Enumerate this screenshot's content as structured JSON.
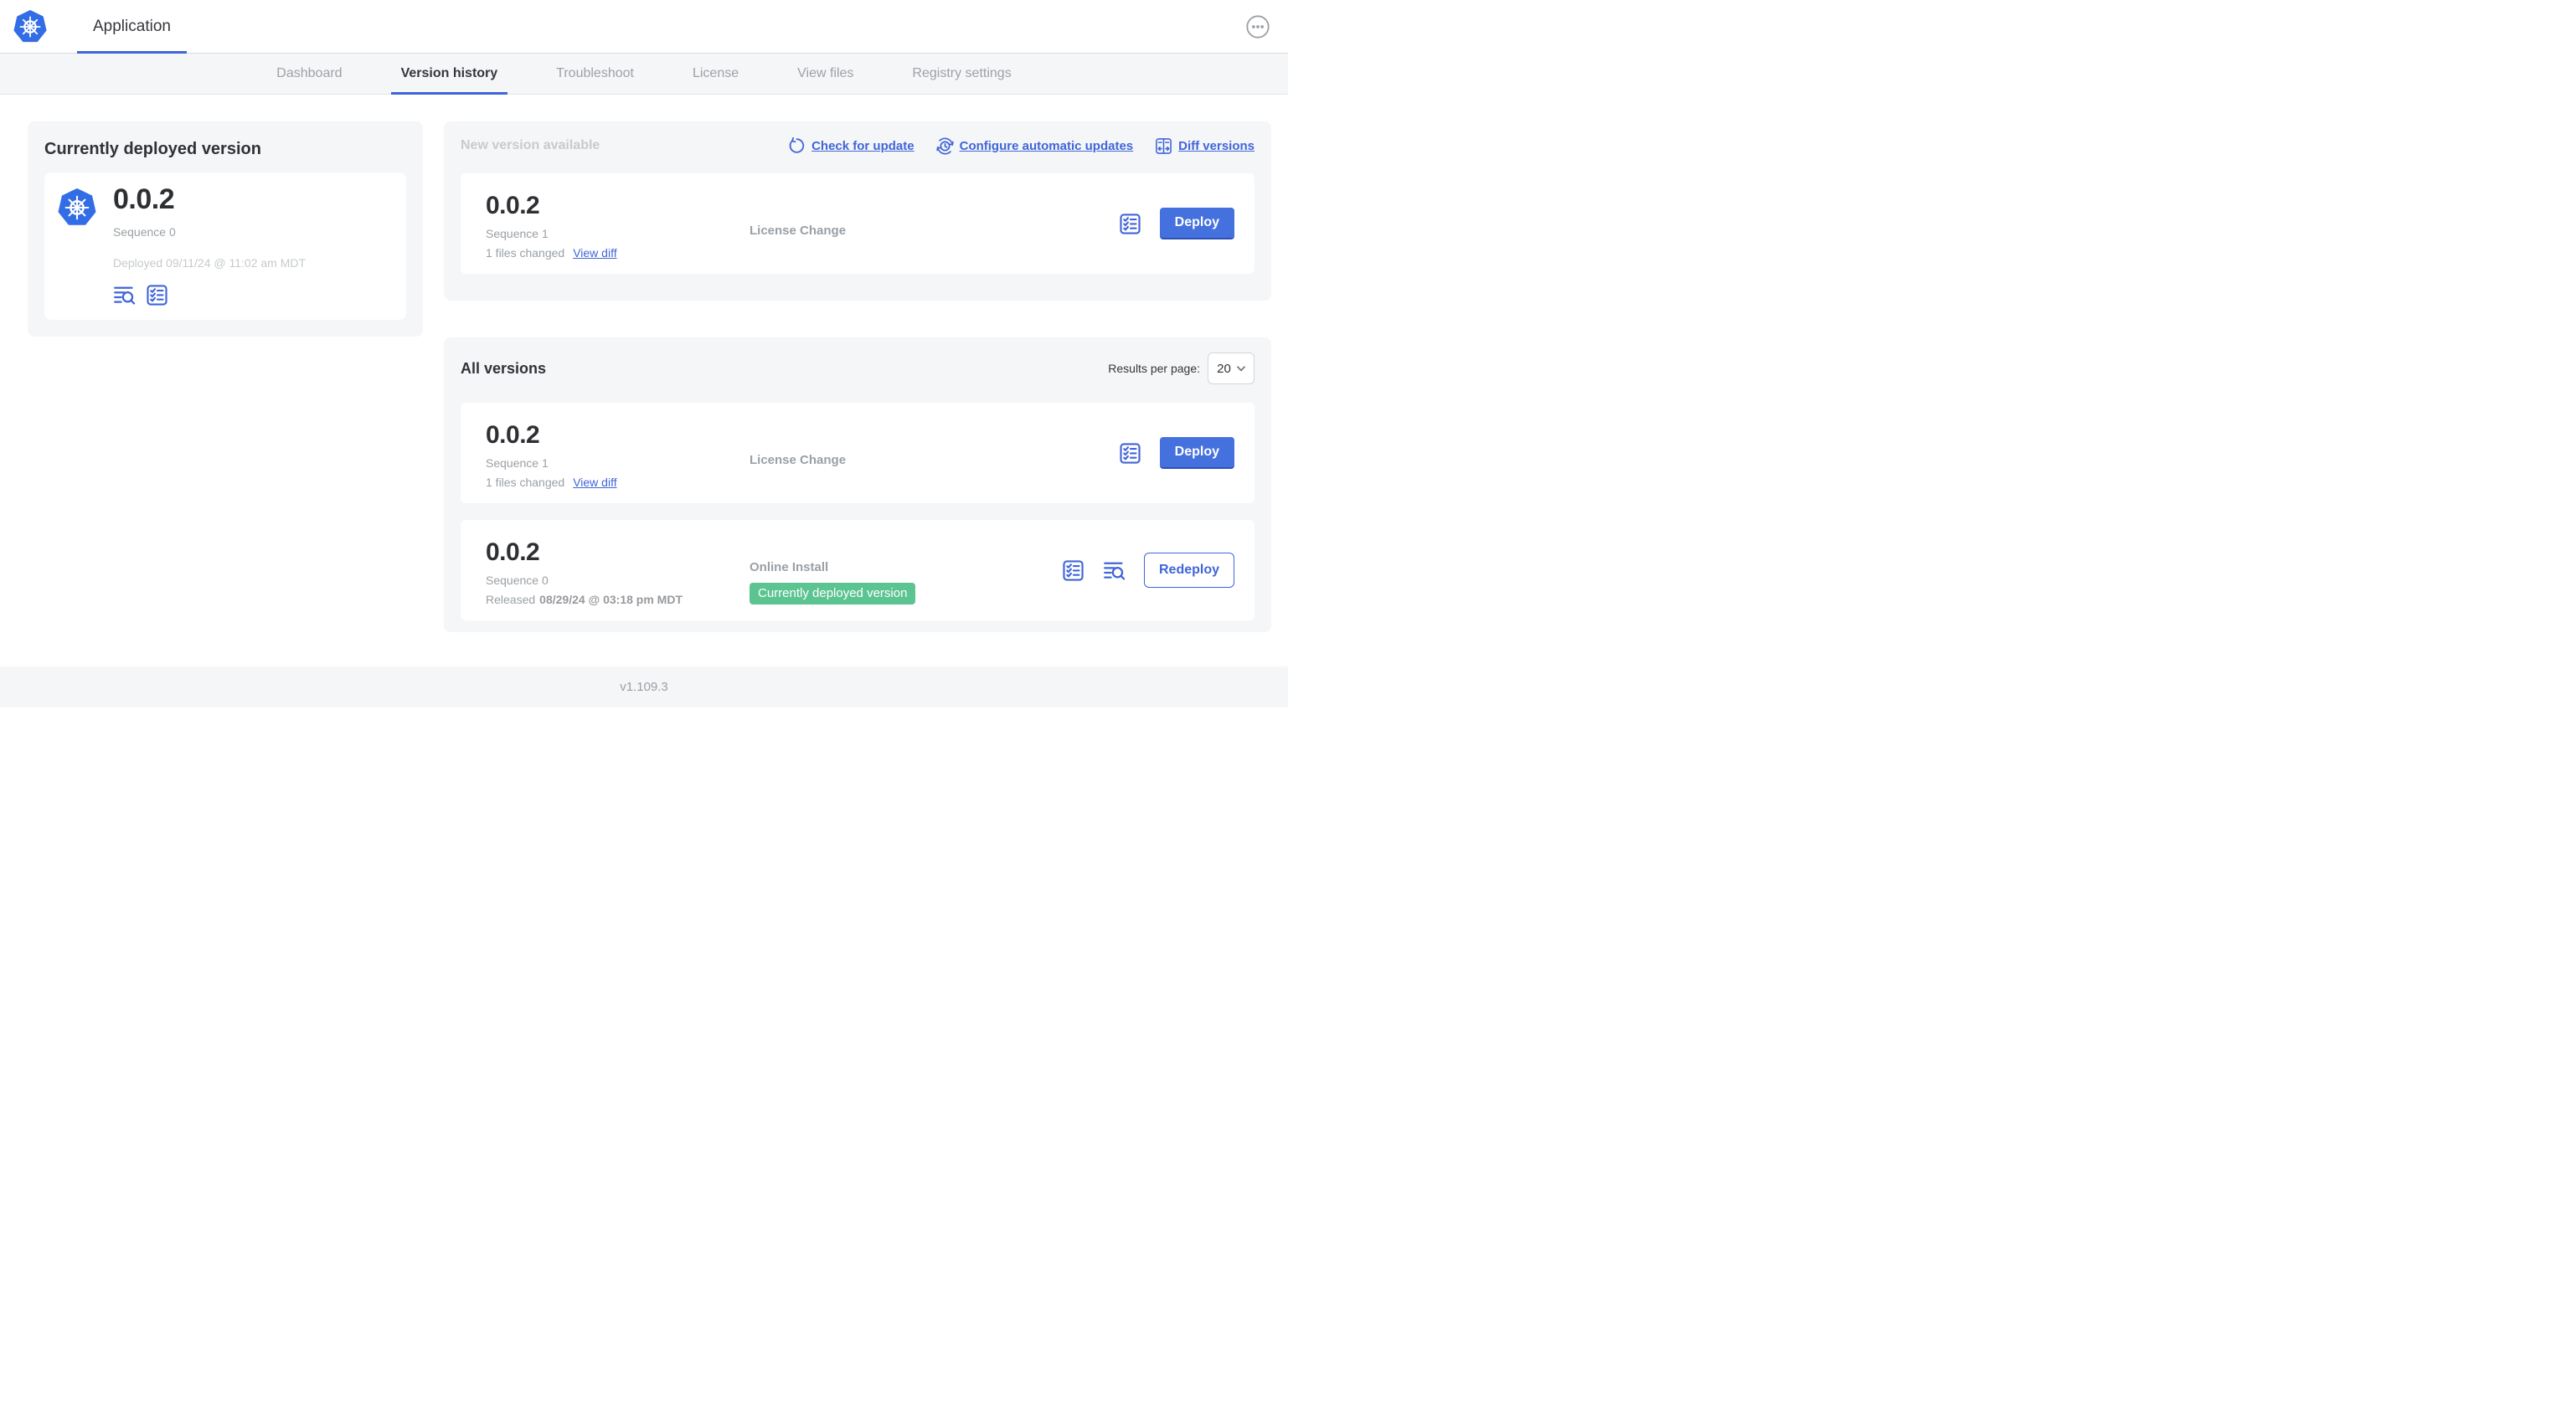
{
  "header": {
    "app_title": "Application"
  },
  "tabs": [
    {
      "label": "Dashboard"
    },
    {
      "label": "Version history"
    },
    {
      "label": "Troubleshoot"
    },
    {
      "label": "License"
    },
    {
      "label": "View files"
    },
    {
      "label": "Registry settings"
    }
  ],
  "currently_deployed": {
    "title": "Currently deployed version",
    "version": "0.0.2",
    "sequence": "Sequence 0",
    "deployed_at": "Deployed 09/11/24 @ 11:02 am MDT"
  },
  "new_version": {
    "title": "New version available",
    "links": [
      {
        "label": "Check for update",
        "icon": "refresh-icon"
      },
      {
        "label": "Configure automatic updates",
        "icon": "schedule-update-icon"
      },
      {
        "label": "Diff versions",
        "icon": "diff-icon"
      }
    ],
    "entry": {
      "version": "0.0.2",
      "sequence": "Sequence 1",
      "files_changed": "1 files changed",
      "view_diff_label": "View diff",
      "source": "License Change",
      "deploy_label": "Deploy"
    }
  },
  "all_versions": {
    "title": "All versions",
    "results_per_page_label": "Results per page:",
    "results_per_page_value": "20",
    "rows": [
      {
        "version": "0.0.2",
        "sequence": "Sequence 1",
        "files_changed": "1 files changed",
        "view_diff_label": "View diff",
        "source": "License Change",
        "deploy_label": "Deploy"
      },
      {
        "version": "0.0.2",
        "sequence": "Sequence 0",
        "released_label": "Released",
        "released_at": "08/29/24 @ 03:18 pm MDT",
        "source": "Online Install",
        "badge": "Currently deployed version",
        "redeploy_label": "Redeploy"
      }
    ]
  },
  "footer": {
    "version": "v1.109.3"
  },
  "colors": {
    "accent_blue": "#4065d8",
    "button_blue": "#4571de",
    "kubernetes_blue": "#326de6",
    "badge_green": "#5cc491",
    "card_background": "#f5f6f8"
  }
}
